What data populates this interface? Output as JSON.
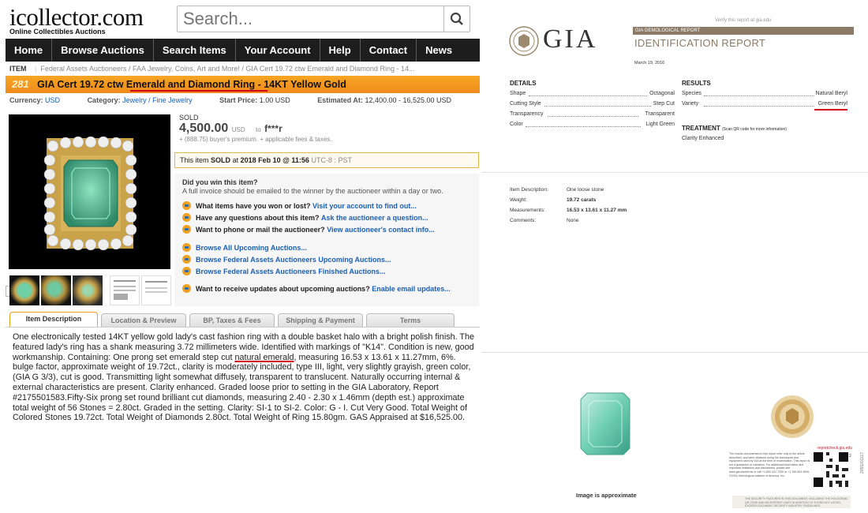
{
  "site": {
    "logo": "icollector.com",
    "tagline": "Online Collectibles Auctions",
    "search_placeholder": "Search..."
  },
  "nav": [
    "Home",
    "Browse Auctions",
    "Search Items",
    "Your Account",
    "Help",
    "Contact",
    "News"
  ],
  "breadcrumb": {
    "label": "ITEM",
    "items": [
      "Federal Assets Auctioneers",
      "FAA Jewelry, Coins, Art and More!",
      "GIA Cert 19.72 ctw Emerald and Diamond Ring - 14..."
    ]
  },
  "lot": {
    "number": "281",
    "title": "GIA Cert 19.72 ctw Emerald and Diamond Ring - 14KT Yellow Gold"
  },
  "meta": {
    "currency_label": "Currency:",
    "currency": "USD",
    "category_label": "Category:",
    "category": "Jewelry / Fine Jewelry",
    "start_label": "Start Price:",
    "start": "1.00 USD",
    "estimate_label": "Estimated At:",
    "estimate": "12,400.00 - 16,525.00 USD"
  },
  "sale": {
    "status": "SOLD",
    "price": "4,500.00",
    "currency": "USD",
    "to_label": "to",
    "buyer": "f***r",
    "premium": "+ (888.75) buyer's premium. + applicable fees & taxes.",
    "sold_at_prefix": "This item",
    "sold_word": "SOLD",
    "at_word": "at",
    "sold_date": "2018 Feb 10 @ 11:56",
    "tz": "UTC-8 : PST"
  },
  "info": {
    "won_q": "Did you win this item?",
    "won_text": "A full invoice should be emailed to the winner by the auctioneer within a day or two.",
    "rows": [
      {
        "q": "What items have you won or lost?",
        "link": "Visit your account to find out..."
      },
      {
        "q": "Have any questions about this item?",
        "link": "Ask the auctioneer a question..."
      },
      {
        "q": "Want to phone or mail the auctioneer?",
        "link": "View auctioneer's contact info..."
      }
    ],
    "browse": [
      "Browse All Upcoming Auctions...",
      "Browse Federal Assets Auctioneers Upcoming Auctions...",
      "Browse Federal Assets Auctioneers Finished Auctions..."
    ],
    "updates_q": "Want to receive updates about upcoming auctions?",
    "updates_link": "Enable email updates..."
  },
  "tabs": [
    "Item Description",
    "Location & Preview",
    "BP, Taxes & Fees",
    "Shipping & Payment",
    "Terms"
  ],
  "description": {
    "part1": "One electronically tested 14KT yellow gold lady's cast fashion ring with a double basket halo with a bright polish finish. The featured lady's ring has a shank measuring 3.72 millimeters wide. Identified with markings of \"K14\". Condition is new, good workmanship. Containing: One prong set emerald step cut ",
    "highlight": "natural emerald",
    "part2": ", measuring 16.53 x 13.61 x 11.27mm, 6%. bulge factor, approximate weight of 19.72ct., clarity is moderately included, type III, light, very slightly grayish, green color, (GIA G 3/3), cut is good. Transmitting light somewhat diffusely, transparent to translucent. Naturally occurring internal & external characteristics are present. Clarity enhanced. Graded loose prior to setting in the GIA Laboratory, Report #2175501583.Fifty-Six prong set round brilliant cut diamonds, measuring 2.40 - 2.30 x 1.46mm (depth est.) approximate total weight of 56 Stones = 2.80ct. Graded in the setting. Clarity: SI-1 to SI-2. Color: G - I. Cut Very Good. Total Weight of Colored Stones 19.72ct. Total Weight of Diamonds 2.80ct. Total Weight of Ring 15.80gm. GAS Appraised at $16,525.00."
  },
  "gia": {
    "verify": "Verify this report at gia.edu",
    "brand": "GIA",
    "report_kind": "GIA GEMOLOGICAL REPORT",
    "report_title": "IDENTIFICATION REPORT",
    "date": "March 19, 2016",
    "details_h": "DETAILS",
    "results_h": "RESULTS",
    "details": [
      [
        "Shape",
        "Octagonal"
      ],
      [
        "Cutting Style",
        "Step Cut"
      ],
      [
        "Transparency",
        "Transparent"
      ],
      [
        "Color",
        "Light Green"
      ]
    ],
    "results": [
      [
        "Species",
        "Natural Beryl"
      ],
      [
        "Variety",
        "Green Beryl"
      ]
    ],
    "treatment_h": "TREATMENT",
    "treatment_note": "(Scan QR code for more information)",
    "treatment": "Clarity Enhanced",
    "item": [
      [
        "Item Description:",
        "One loose stone"
      ],
      [
        "Weight:",
        "19.72 carats"
      ],
      [
        "Measurements:",
        "16.53 x 13.61 x 11.27 mm"
      ],
      [
        "Comments:",
        "None"
      ]
    ],
    "image_caption": "Image is approximate",
    "reportcheck": "reportcheck.gia.edu",
    "fine_print": "The results documented in this report refer only to the article described, and were obtained using the techniques and equipment used by GIA at the time of examination. This report is not a guarantee or valuation. For additional information and important limitations and disclaimers, please see www.gia.edu/terms or call +1 800 421 7250 or +1 760 603 4500. ©2016 Gemological Institute of America, Inc.",
    "security": "THE SECURITY FEATURES IN THIS DOCUMENT, INCLUDING THE HOLOGRAM, QR CODE AND MICROPRINT LINES IN ADDITION TO THOSE NOT LISTED, EXCEED DOCUMENT SECURITY INDUSTRY GUIDELINES.",
    "serial": "2055201117",
    "qr_number": "2"
  },
  "colors": {
    "accent": "#f08a1c",
    "nav_bg": "#1d1d1d",
    "link": "#1a5fb4",
    "underline": "#d0021b",
    "gia_bar": "#8a7a66"
  }
}
